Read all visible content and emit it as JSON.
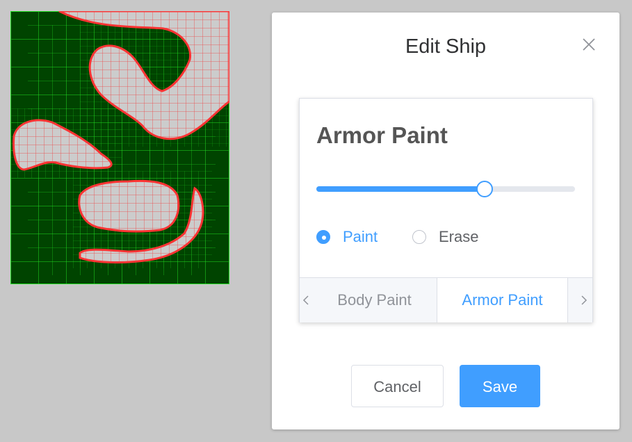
{
  "dialog": {
    "title": "Edit Ship",
    "close_icon": "close-icon"
  },
  "panel": {
    "title": "Armor Paint",
    "brush_slider_value": 0.65,
    "modes": [
      {
        "label": "Paint",
        "selected": true
      },
      {
        "label": "Erase",
        "selected": false
      }
    ],
    "tabs": [
      {
        "label": "Body Paint",
        "active": false
      },
      {
        "label": "Armor Paint",
        "active": true
      }
    ]
  },
  "buttons": {
    "cancel": "Cancel",
    "save": "Save"
  },
  "colors": {
    "accent": "#409eff",
    "ship_hull": "#004400",
    "ship_grid": "#22dd22",
    "armor_fill": "#cccccc",
    "armor_edge": "#ff3333"
  }
}
